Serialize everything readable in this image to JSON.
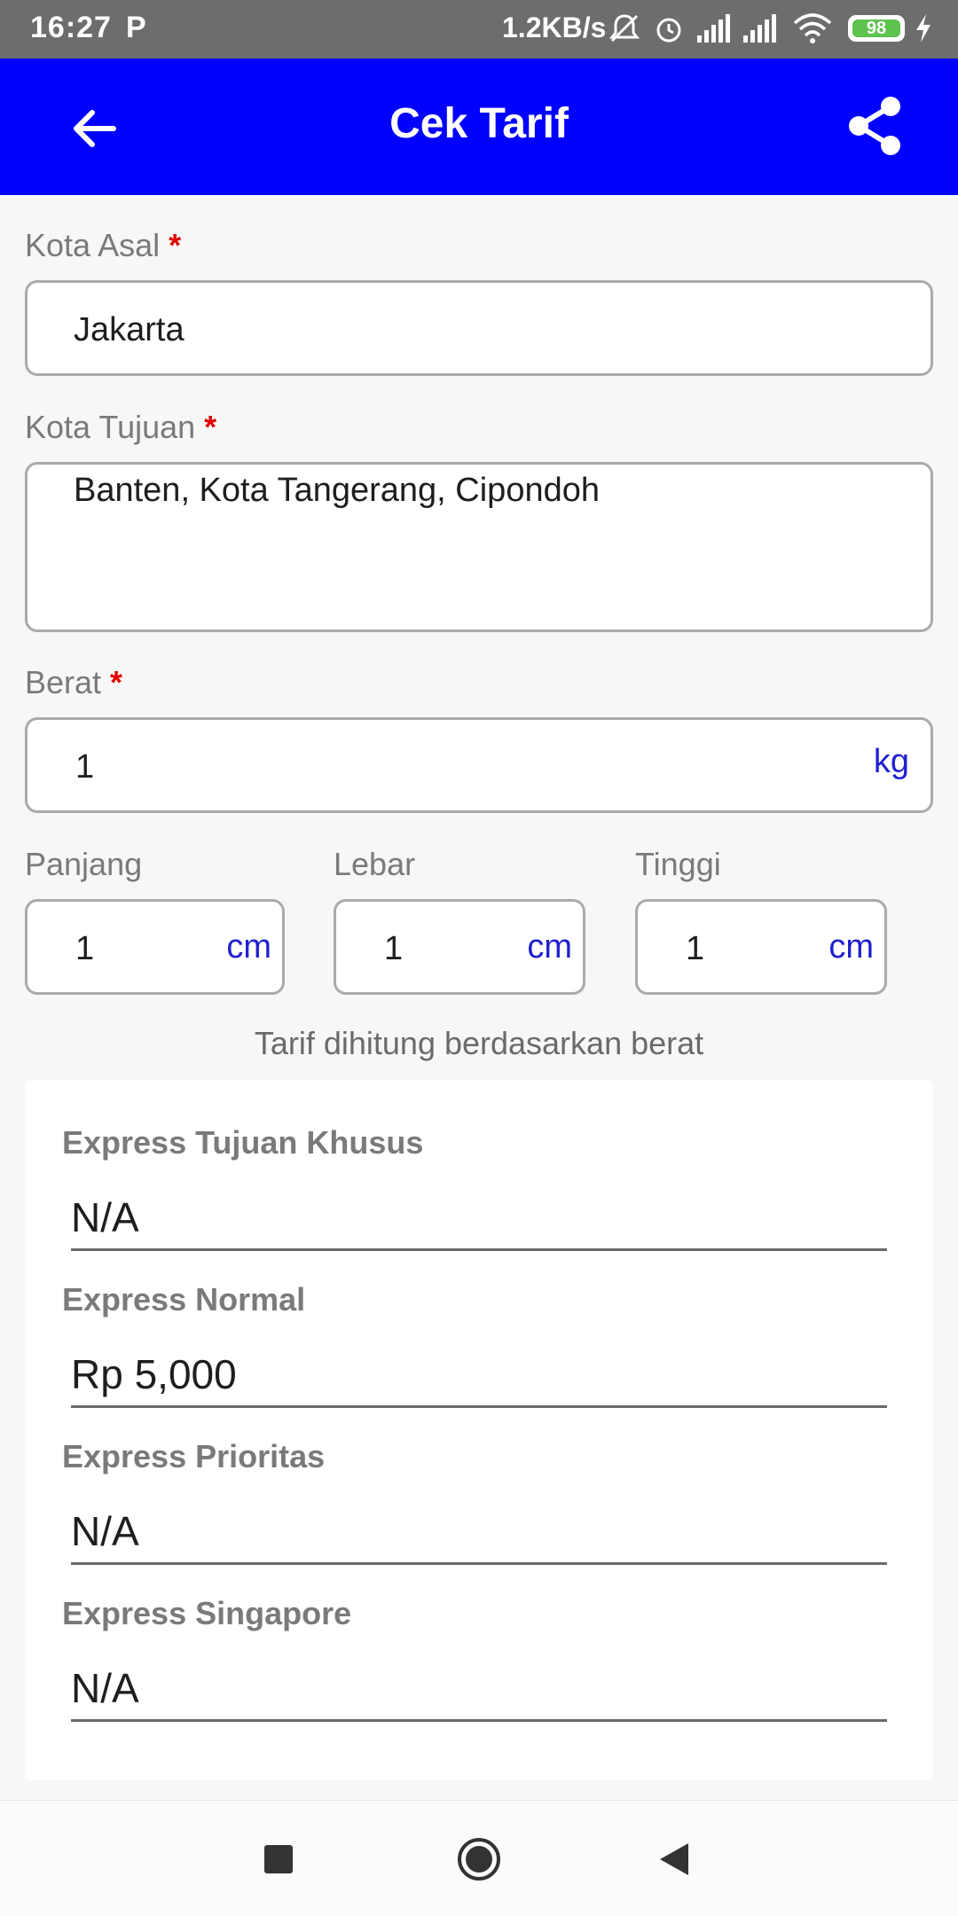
{
  "status_bar": {
    "time": "16:27",
    "notification_icon": "P",
    "speed": "1.2KB/s",
    "battery": "98",
    "icons": [
      "mute-icon",
      "alarm-icon",
      "signal-icon",
      "signal-icon",
      "wifi-icon",
      "battery-icon",
      "charging-icon"
    ]
  },
  "appbar": {
    "title": "Cek Tarif",
    "bg_color": "#0000ff"
  },
  "form": {
    "origin": {
      "label": "Kota Asal",
      "required": "*",
      "value": "Jakarta"
    },
    "destination": {
      "label": "Kota Tujuan",
      "required": "*",
      "value": "Banten, Kota Tangerang, Cipondoh"
    },
    "weight": {
      "label": "Berat",
      "required": "*",
      "value": "1",
      "unit": "kg"
    },
    "length": {
      "label": "Panjang",
      "value": "1",
      "unit": "cm"
    },
    "width": {
      "label": "Lebar",
      "value": "1",
      "unit": "cm"
    },
    "height": {
      "label": "Tinggi",
      "value": "1",
      "unit": "cm"
    }
  },
  "note": "Tarif dihitung berdasarkan berat",
  "rates": [
    {
      "label": "Express Tujuan Khusus",
      "value": "N/A"
    },
    {
      "label": "Express Normal",
      "value": "Rp 5,000"
    },
    {
      "label": "Express Prioritas",
      "value": "N/A"
    },
    {
      "label": "Express Singapore",
      "value": "N/A"
    }
  ],
  "navbar": [
    "recents-button",
    "home-button",
    "back-button"
  ]
}
